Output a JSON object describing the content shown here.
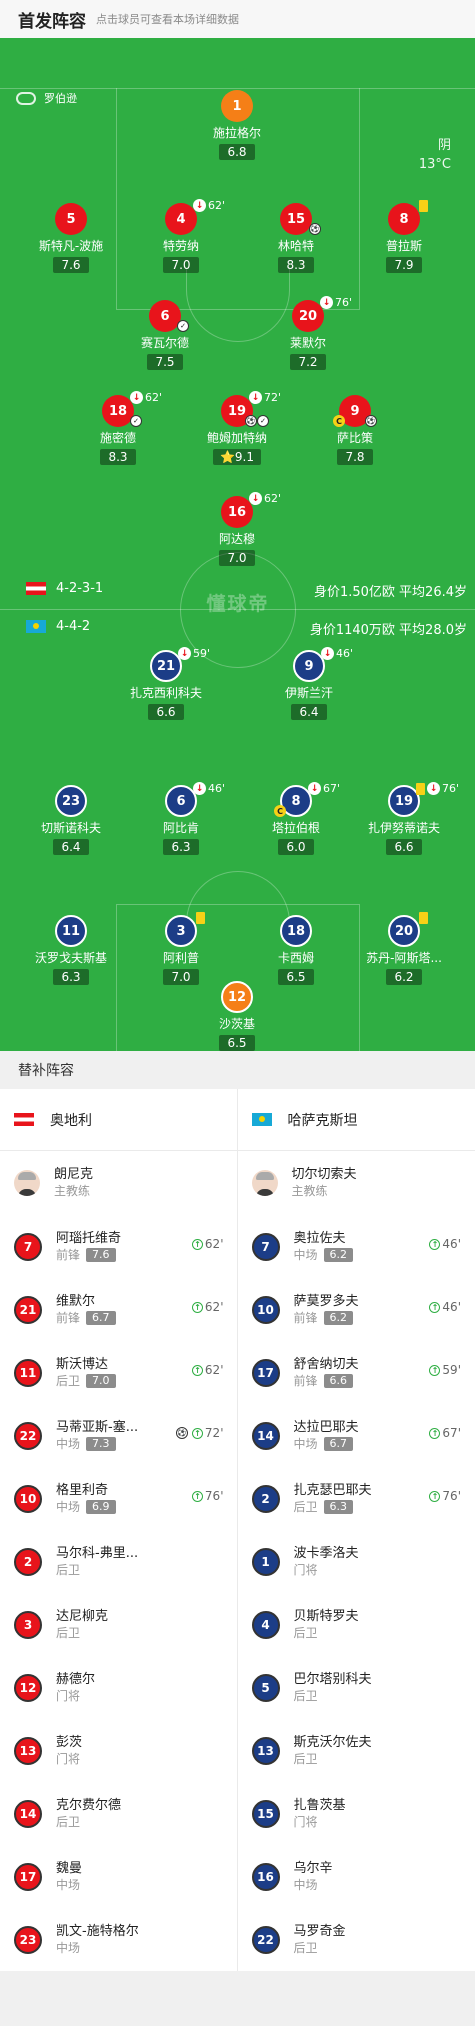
{
  "header": {
    "title": "首发阵容",
    "subtitle": "点击球员可查看本场详细数据"
  },
  "referee": "罗伯逊",
  "weather": {
    "condition": "阴",
    "temp": "13°C"
  },
  "home": {
    "formation": "4-2-3-1",
    "value": "身价1.50亿欧",
    "age": "平均26.4岁",
    "name": "奥地利"
  },
  "away": {
    "formation": "4-4-2",
    "value": "身价1140万欧",
    "age": "平均28.0岁",
    "name": "哈萨克斯坦"
  },
  "logo_text": "懂球帝",
  "home_players": [
    {
      "num": "1",
      "name": "施拉格尔",
      "rating": "6.8"
    },
    {
      "num": "5",
      "name": "斯特凡-波施",
      "rating": "7.6"
    },
    {
      "num": "4",
      "name": "特劳纳",
      "rating": "7.0",
      "sub": "62'"
    },
    {
      "num": "15",
      "name": "林哈特",
      "rating": "8.3"
    },
    {
      "num": "8",
      "name": "普拉斯",
      "rating": "7.9"
    },
    {
      "num": "6",
      "name": "赛瓦尔德",
      "rating": "7.5"
    },
    {
      "num": "20",
      "name": "莱默尔",
      "rating": "7.2",
      "sub": "76'"
    },
    {
      "num": "18",
      "name": "施密德",
      "rating": "8.3",
      "sub": "62'"
    },
    {
      "num": "19",
      "name": "鲍姆加特纳",
      "rating": "9.1",
      "sub": "72'"
    },
    {
      "num": "9",
      "name": "萨比策",
      "rating": "7.8"
    },
    {
      "num": "16",
      "name": "阿达穆",
      "rating": "7.0",
      "sub": "62'"
    }
  ],
  "away_players": [
    {
      "num": "21",
      "name": "扎克西利科夫",
      "rating": "6.6",
      "sub": "59'"
    },
    {
      "num": "9",
      "name": "伊斯兰汗",
      "rating": "6.4",
      "sub": "46'"
    },
    {
      "num": "23",
      "name": "切斯诺科夫",
      "rating": "6.4"
    },
    {
      "num": "6",
      "name": "阿比肯",
      "rating": "6.3",
      "sub": "46'"
    },
    {
      "num": "8",
      "name": "塔拉伯根",
      "rating": "6.0",
      "sub": "67'"
    },
    {
      "num": "19",
      "name": "扎伊努蒂诺夫",
      "rating": "6.6",
      "sub": "76'"
    },
    {
      "num": "11",
      "name": "沃罗戈夫斯基",
      "rating": "6.3"
    },
    {
      "num": "3",
      "name": "阿利普",
      "rating": "7.0"
    },
    {
      "num": "18",
      "name": "卡西姆",
      "rating": "6.5"
    },
    {
      "num": "20",
      "name": "苏丹-阿斯塔...",
      "rating": "6.2"
    },
    {
      "num": "12",
      "name": "沙茨基",
      "rating": "6.5"
    }
  ],
  "subs_title": "替补阵容",
  "home_coach": {
    "name": "朗尼克",
    "role": "主教练"
  },
  "away_coach": {
    "name": "切尔切索夫",
    "role": "主教练"
  },
  "home_subs": [
    {
      "num": "7",
      "name": "阿瑙托维奇",
      "pos": "前锋",
      "rating": "7.6",
      "in": "62'"
    },
    {
      "num": "21",
      "name": "维默尔",
      "pos": "前锋",
      "rating": "6.7",
      "in": "62'"
    },
    {
      "num": "11",
      "name": "斯沃博达",
      "pos": "后卫",
      "rating": "7.0",
      "in": "62'"
    },
    {
      "num": "22",
      "name": "马蒂亚斯-塞...",
      "pos": "中场",
      "rating": "7.3",
      "in": "72'"
    },
    {
      "num": "10",
      "name": "格里利奇",
      "pos": "中场",
      "rating": "6.9",
      "in": "76'"
    },
    {
      "num": "2",
      "name": "马尔科-弗里...",
      "pos": "后卫"
    },
    {
      "num": "3",
      "name": "达尼柳克",
      "pos": "后卫"
    },
    {
      "num": "12",
      "name": "赫德尔",
      "pos": "门将"
    },
    {
      "num": "13",
      "name": "彭茨",
      "pos": "门将"
    },
    {
      "num": "14",
      "name": "克尔费尔德",
      "pos": "后卫"
    },
    {
      "num": "17",
      "name": "魏曼",
      "pos": "中场"
    },
    {
      "num": "23",
      "name": "凯文-施特格尔",
      "pos": "中场"
    }
  ],
  "away_subs": [
    {
      "num": "7",
      "name": "奥拉佐夫",
      "pos": "中场",
      "rating": "6.2",
      "in": "46'"
    },
    {
      "num": "10",
      "name": "萨莫罗多夫",
      "pos": "前锋",
      "rating": "6.2",
      "in": "46'"
    },
    {
      "num": "17",
      "name": "舒舍纳切夫",
      "pos": "前锋",
      "rating": "6.6",
      "in": "59'"
    },
    {
      "num": "14",
      "name": "达拉巴耶夫",
      "pos": "中场",
      "rating": "6.7",
      "in": "67'"
    },
    {
      "num": "2",
      "name": "扎克瑟巴耶夫",
      "pos": "后卫",
      "rating": "6.3",
      "in": "76'"
    },
    {
      "num": "1",
      "name": "波卡季洛夫",
      "pos": "门将"
    },
    {
      "num": "4",
      "name": "贝斯特罗夫",
      "pos": "后卫"
    },
    {
      "num": "5",
      "name": "巴尔塔别科夫",
      "pos": "后卫"
    },
    {
      "num": "13",
      "name": "斯克沃尔佐夫",
      "pos": "后卫"
    },
    {
      "num": "15",
      "name": "扎鲁茨基",
      "pos": "门将"
    },
    {
      "num": "16",
      "name": "乌尔辛",
      "pos": "中场"
    },
    {
      "num": "22",
      "name": "马罗奇金",
      "pos": "后卫"
    }
  ],
  "colors": {
    "pitch": "#2fae43",
    "home": "#e8141b",
    "away": "#1c3d87",
    "goalkeeper": "#f57f17"
  }
}
